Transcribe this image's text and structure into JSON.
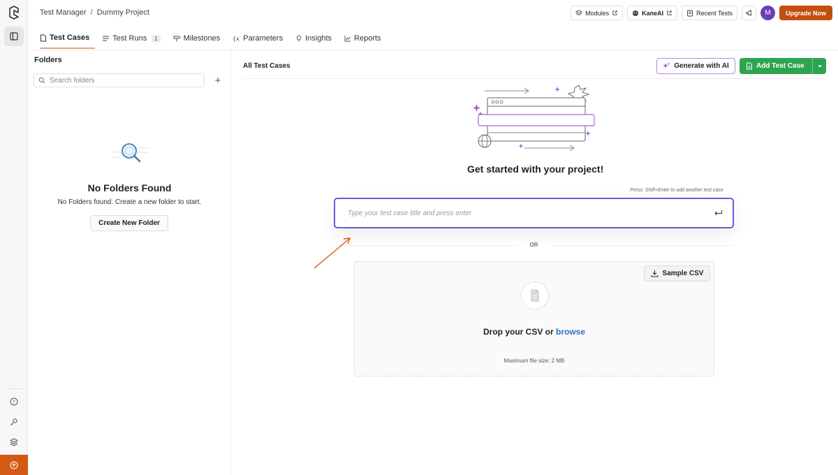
{
  "breadcrumb": {
    "app": "Test Manager",
    "separator": "/",
    "project": "Dummy Project"
  },
  "header": {
    "modules_label": "Modules",
    "kaneai_label": "KaneAI",
    "recent_tests_label": "Recent Tests",
    "avatar_initial": "M",
    "upgrade_label": "Upgrade Now"
  },
  "tabs": [
    {
      "label": "Test Cases",
      "icon": "file-icon",
      "active": true
    },
    {
      "label": "Test Runs",
      "icon": "list-icon",
      "count": "1"
    },
    {
      "label": "Milestones",
      "icon": "signpost-icon"
    },
    {
      "label": "Parameters",
      "icon": "braces-icon"
    },
    {
      "label": "Insights",
      "icon": "bulb-icon"
    },
    {
      "label": "Reports",
      "icon": "chart-line-icon"
    }
  ],
  "folders": {
    "title": "Folders",
    "search_placeholder": "Search folders",
    "empty_title": "No Folders Found",
    "empty_subtitle": "No Folders found. Create a new folder to start.",
    "create_button": "Create New Folder"
  },
  "main": {
    "heading": "All Test Cases",
    "generate_ai_label": "Generate with AI",
    "add_test_case_label": "Add Test Case",
    "get_started": "Get started with your project!",
    "hint": "Press: Shift+Enter to add another test case",
    "input_placeholder": "Type your test case title and press enter",
    "or_label": "OR",
    "sample_csv_label": "Sample CSV",
    "drop_text": "Drop your CSV or ",
    "browse_label": "browse",
    "max_size": "Maximum file size: 2 MB"
  },
  "colors": {
    "upgrade": "#c24f0e",
    "add_test_case": "#2ea44f",
    "input_focus": "#6a5adc",
    "generate_ai_border": "#b88be0",
    "browse_link": "#2a6fc0",
    "rail_bottom": "#d35a12",
    "annotation_arrow": "#e0531b"
  }
}
